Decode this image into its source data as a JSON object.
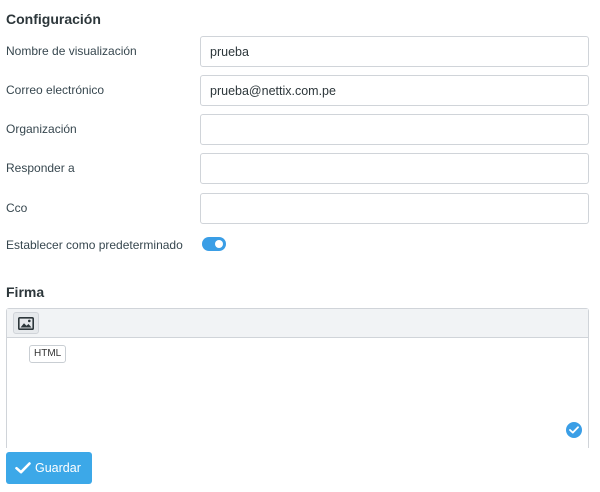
{
  "settings": {
    "title": "Configuración",
    "fields": [
      {
        "label": "Nombre de visualización",
        "value": "prueba",
        "placeholder": ""
      },
      {
        "label": "Correo electrónico",
        "value": "prueba@nettix.com.pe",
        "placeholder": ""
      },
      {
        "label": "Organización",
        "value": "",
        "placeholder": ""
      },
      {
        "label": "Responder a",
        "value": "",
        "placeholder": ""
      },
      {
        "label": "Cco",
        "value": "",
        "placeholder": ""
      }
    ],
    "default_toggle": {
      "label": "Establecer como predeterminado",
      "on": true
    }
  },
  "signature": {
    "title": "Firma",
    "html_chip": "HTML"
  },
  "actions": {
    "save_label": "Guardar"
  },
  "colors": {
    "accent": "#3ca8e8",
    "toggle": "#3a9ee6"
  }
}
